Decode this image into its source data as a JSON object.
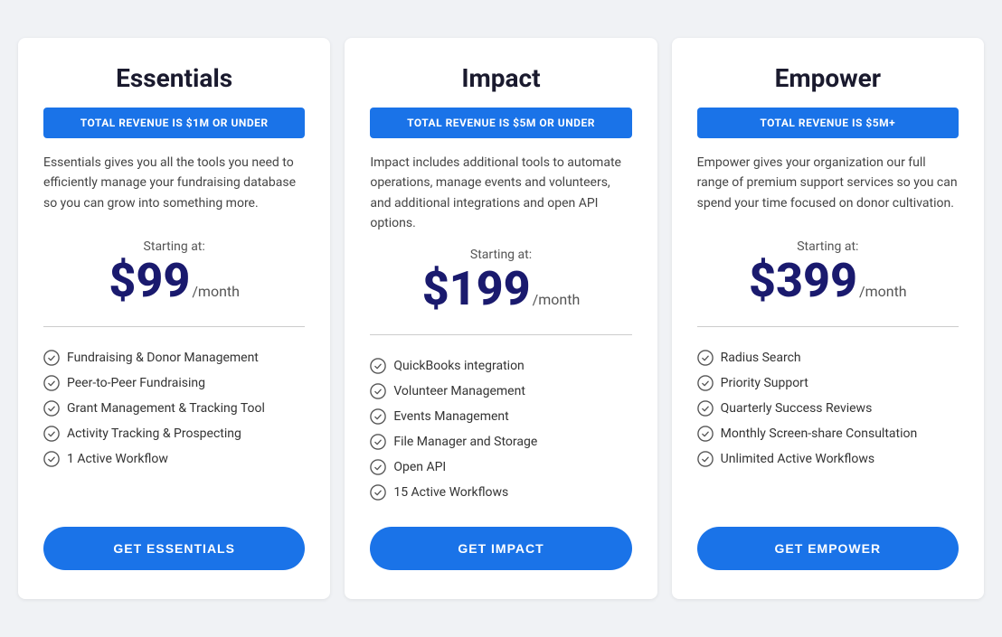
{
  "plans": [
    {
      "id": "essentials",
      "title": "Essentials",
      "badge": "TOTAL REVENUE IS $1M OR UNDER",
      "description": "Essentials gives you all the tools you need to efficiently manage your   fundraising database so you can grow into something more.",
      "starting_at_label": "Starting at:",
      "price": "$99",
      "period": "/month",
      "features": [
        "Fundraising & Donor Management",
        "Peer-to-Peer Fundraising",
        "Grant Management & Tracking Tool",
        "Activity Tracking & Prospecting",
        "1 Active Workflow"
      ],
      "cta_label": "GET ESSENTIALS"
    },
    {
      "id": "impact",
      "title": "Impact",
      "badge": "TOTAL REVENUE IS $5M OR UNDER",
      "description": "Impact includes additional tools to automate operations, manage events and volunteers, and additional integrations and open API options.",
      "starting_at_label": "Starting at:",
      "price": "$199",
      "period": "/month",
      "features": [
        "QuickBooks integration",
        "Volunteer Management",
        "Events Management",
        "File Manager and Storage",
        "Open API",
        "15 Active Workflows"
      ],
      "cta_label": "GET IMPACT"
    },
    {
      "id": "empower",
      "title": "Empower",
      "badge": "TOTAL REVENUE IS $5M+",
      "description": "Empower gives your organization our full range of premium support services so you can spend your time focused on donor cultivation.",
      "starting_at_label": "Starting at:",
      "price": "$399",
      "period": "/month",
      "features": [
        "Radius Search",
        "Priority Support",
        "Quarterly Success Reviews",
        "Monthly Screen-share Consultation",
        "Unlimited Active Workflows"
      ],
      "cta_label": "GET EMPOWER"
    }
  ],
  "icons": {
    "check": "check-circle-icon"
  }
}
